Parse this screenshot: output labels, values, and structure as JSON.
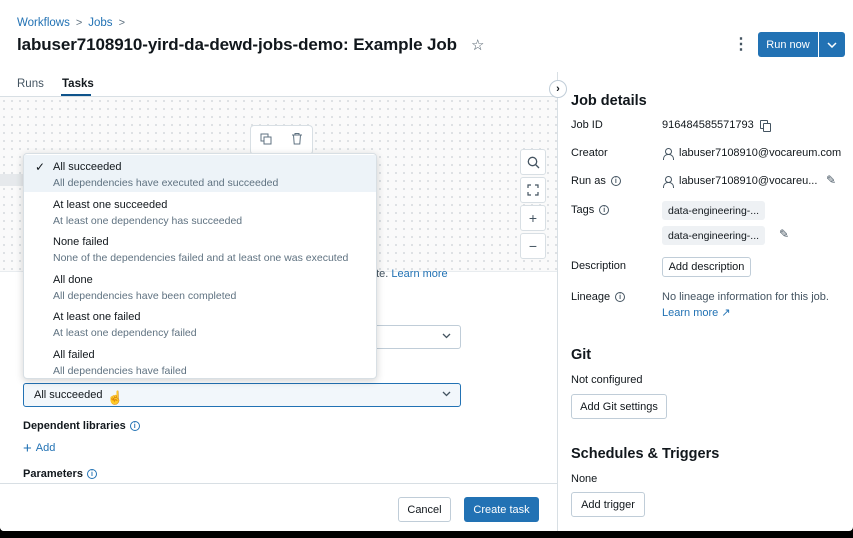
{
  "breadcrumb": {
    "items": [
      "Workflows",
      "Jobs"
    ],
    "separator": ">"
  },
  "job": {
    "title": "labuser7108910-yird-da-dewd-jobs-demo: Example Job"
  },
  "header": {
    "run_now_label": "Run now"
  },
  "tabs": [
    {
      "label": "Runs"
    },
    {
      "label": "Tasks"
    }
  ],
  "dropdown": {
    "options": [
      {
        "label": "All succeeded",
        "description": "All dependencies have executed and succeeded",
        "selected": true
      },
      {
        "label": "At least one succeeded",
        "description": "At least one dependency has succeeded"
      },
      {
        "label": "None failed",
        "description": "None of the dependencies failed and at least one was executed"
      },
      {
        "label": "All done",
        "description": "All dependencies have been completed"
      },
      {
        "label": "At least one failed",
        "description": "At least one dependency failed"
      },
      {
        "label": "All failed",
        "description": "All dependencies have failed"
      }
    ]
  },
  "form": {
    "learn_more_prefix": "ute.",
    "learn_more_label": "Learn more",
    "run_if_value": "All succeeded",
    "dependent_libraries_label": "Dependent libraries",
    "add_label": "Add",
    "parameters_label": "Parameters",
    "cancel_label": "Cancel",
    "create_label": "Create task"
  },
  "details": {
    "heading": "Job details",
    "job_id_label": "Job ID",
    "job_id": "916484585571793",
    "creator_label": "Creator",
    "creator": "labuser7108910@vocareum.com",
    "run_as_label": "Run as",
    "run_as": "labuser7108910@vocareu...",
    "tags_label": "Tags",
    "tags": [
      "data-engineering-...",
      "data-engineering-..."
    ],
    "description_label": "Description",
    "add_description_label": "Add description",
    "lineage_label": "Lineage",
    "lineage_text": "No lineage information for this job.",
    "lineage_link": "Learn more"
  },
  "git": {
    "heading": "Git",
    "status": "Not configured",
    "button_label": "Add Git settings"
  },
  "schedules": {
    "heading": "Schedules & Triggers",
    "status": "None",
    "button_label": "Add trigger"
  },
  "colors": {
    "primary": "#2272b4",
    "text": "#11171c",
    "muted": "#5f7281",
    "border": "#d8dfe4"
  }
}
